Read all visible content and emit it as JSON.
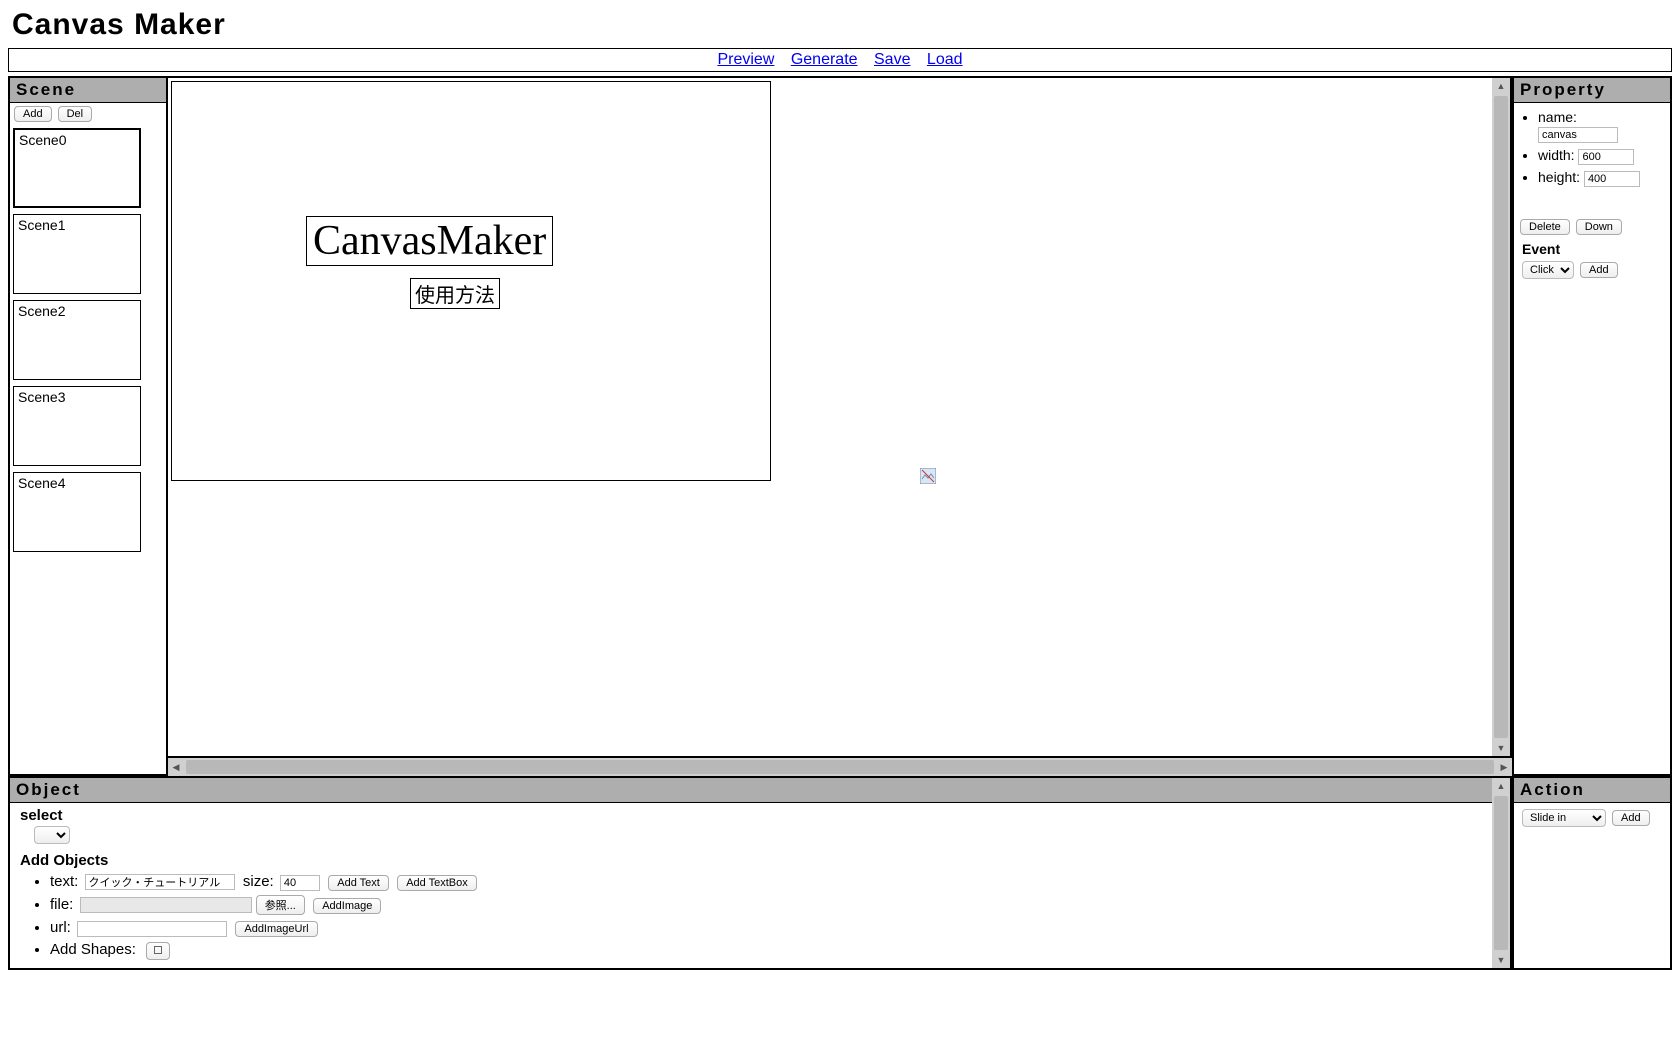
{
  "title": "Canvas Maker",
  "toolbar": {
    "preview": "Preview",
    "generate": "Generate",
    "save": "Save",
    "load": "Load"
  },
  "scene": {
    "header": "Scene",
    "add": "Add",
    "del": "Del",
    "items": [
      {
        "label": "Scene0",
        "selected": true
      },
      {
        "label": "Scene1",
        "selected": false
      },
      {
        "label": "Scene2",
        "selected": false
      },
      {
        "label": "Scene3",
        "selected": false
      },
      {
        "label": "Scene4",
        "selected": false
      }
    ]
  },
  "canvas": {
    "text1": "CanvasMaker",
    "text2": "使用方法"
  },
  "property": {
    "header": "Property",
    "name_label": "name:",
    "name_value": "canvas",
    "width_label": "width:",
    "width_value": "600",
    "height_label": "height:",
    "height_value": "400",
    "delete": "Delete",
    "down": "Down",
    "event_header": "Event",
    "event_select": "Click",
    "event_add": "Add"
  },
  "object": {
    "header": "Object",
    "select_label": "select",
    "addobj_title": "Add Objects",
    "text_label": "text:",
    "text_value": "クイック・チュートリアル",
    "size_label": "size:",
    "size_value": "40",
    "add_text": "Add Text",
    "add_textbox": "Add TextBox",
    "file_label": "file:",
    "file_browse": "参照...",
    "add_image": "AddImage",
    "url_label": "url:",
    "url_value": "",
    "add_image_url": "AddImageUrl",
    "shapes_label": "Add Shapes:"
  },
  "action": {
    "header": "Action",
    "select": "Slide in",
    "add": "Add"
  }
}
